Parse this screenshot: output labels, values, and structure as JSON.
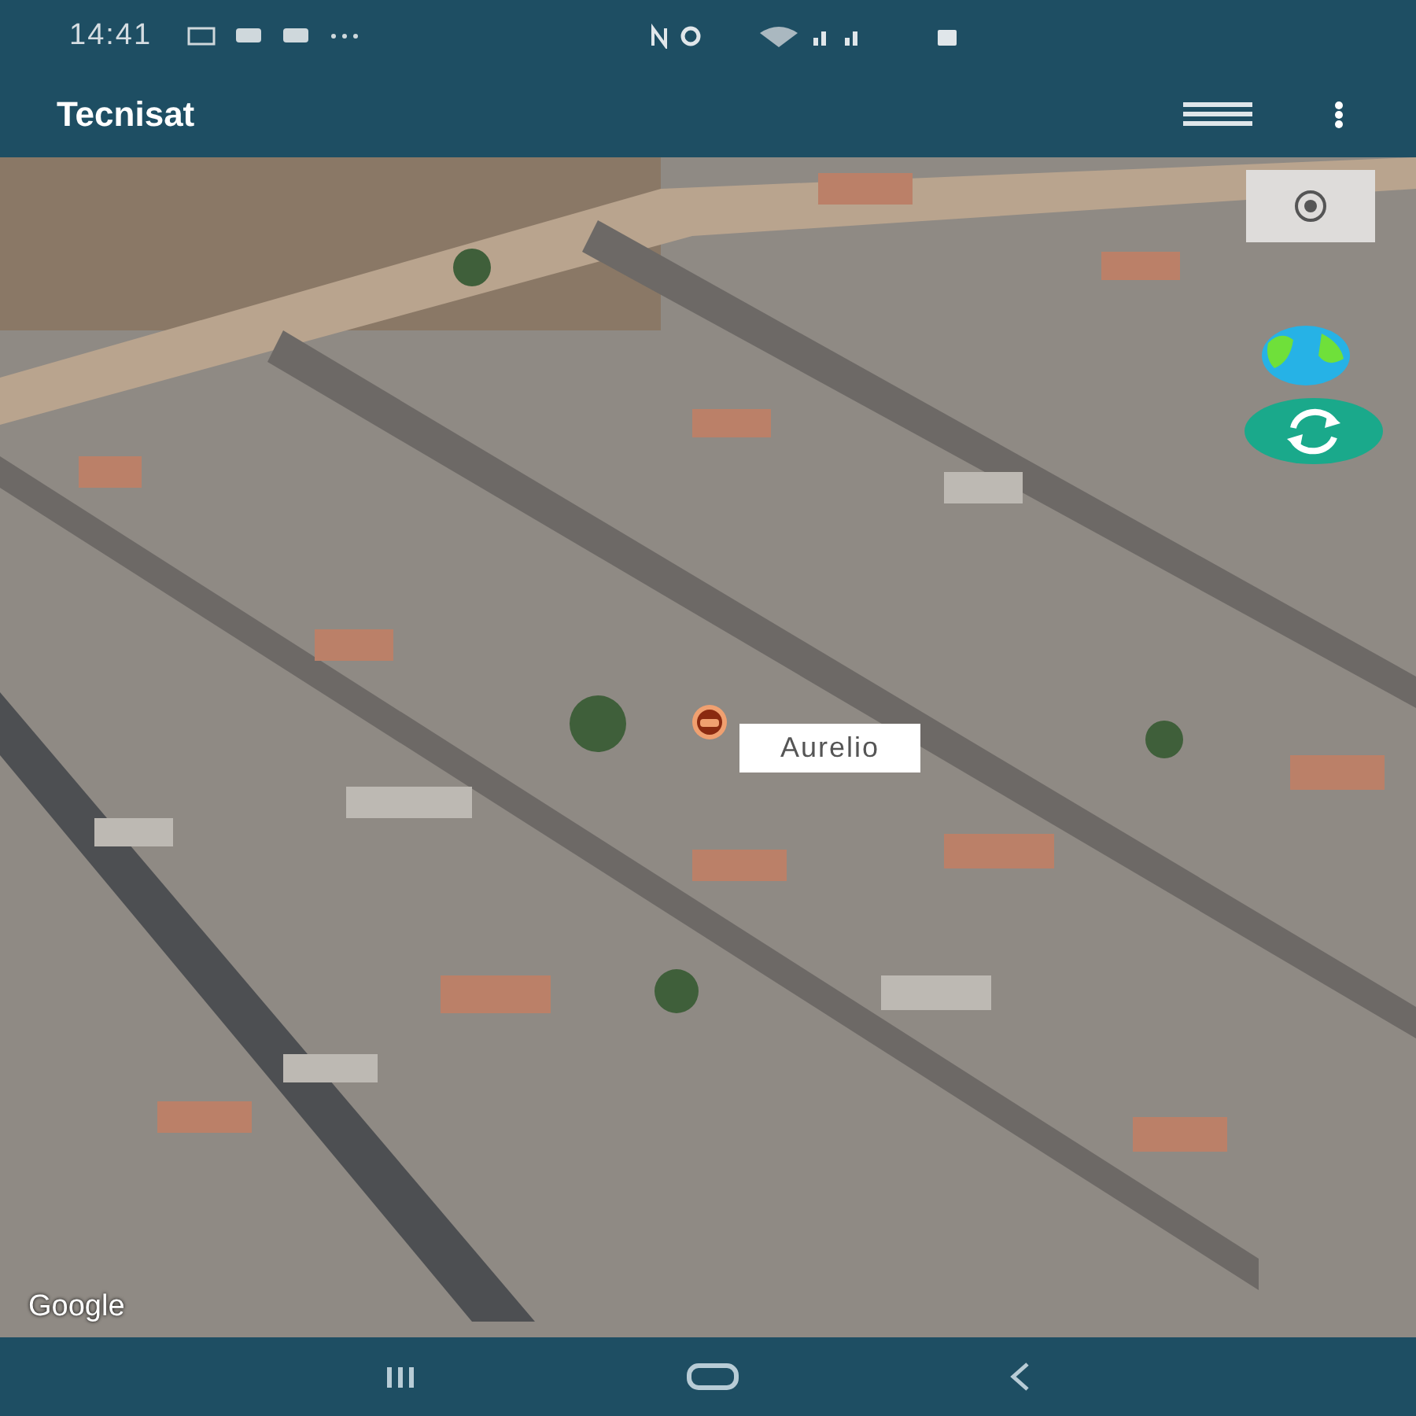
{
  "status_bar": {
    "time": "14:41"
  },
  "app_bar": {
    "title": "Tecnisat"
  },
  "map": {
    "marker": {
      "label": "Aurelio"
    },
    "attribution": "Google"
  }
}
